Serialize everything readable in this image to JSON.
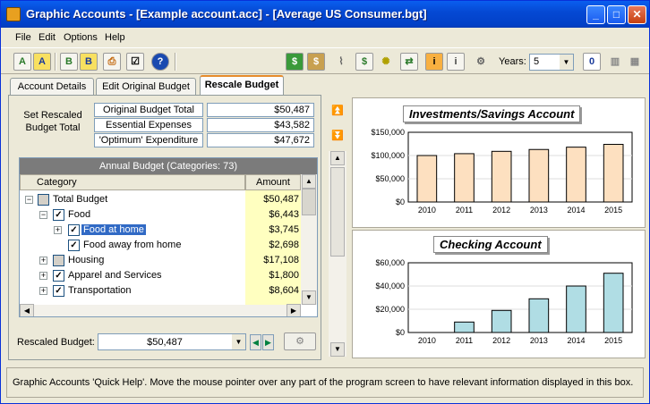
{
  "window": {
    "title": "Graphic Accounts - [Example account.acc] - [Average US Consumer.bgt]",
    "minimize": "_",
    "maximize": "□",
    "close": "✕"
  },
  "menu": [
    "File",
    "Edit",
    "Options",
    "Help"
  ],
  "toolbar": {
    "years_label": "Years:",
    "years_value": "5",
    "zero_button": "0"
  },
  "tabs": [
    "Account Details",
    "Edit Original Budget",
    "Rescale Budget"
  ],
  "summary": {
    "set_label": "Set Rescaled Budget Total",
    "rows": [
      {
        "label": "Original Budget Total",
        "value": "$50,487"
      },
      {
        "label": "Essential Expenses",
        "value": "$43,582"
      },
      {
        "label": "'Optimum' Expenditure",
        "value": "$47,672"
      }
    ]
  },
  "tree": {
    "header": "Annual Budget (Categories:  73)",
    "col_category": "Category",
    "col_amount": "Amount",
    "rows": [
      {
        "label": "Total Budget",
        "amount": "$50,487"
      },
      {
        "label": "Food",
        "amount": "$6,443"
      },
      {
        "label": "Food at home",
        "amount": "$3,745"
      },
      {
        "label": "Food away from home",
        "amount": "$2,698"
      },
      {
        "label": "Housing",
        "amount": "$17,108"
      },
      {
        "label": "Apparel and Services",
        "amount": "$1,800"
      },
      {
        "label": "Transportation",
        "amount": "$8,604"
      }
    ]
  },
  "rescaled": {
    "label": "Rescaled Budget:",
    "value": "$50,487"
  },
  "charts": [
    {
      "title": "Investments/Savings Account",
      "type": "bar",
      "color": "#fde0c0",
      "categories": [
        "2010",
        "2011",
        "2012",
        "2013",
        "2014",
        "2015"
      ],
      "values": [
        100000,
        104000,
        109000,
        113000,
        118000,
        124000
      ],
      "ylim": [
        0,
        150000
      ],
      "yticks": [
        "$0",
        "$50,000",
        "$100,000",
        "$150,000"
      ]
    },
    {
      "title": "Checking Account",
      "type": "bar",
      "color": "#b0dde4",
      "categories": [
        "2010",
        "2011",
        "2012",
        "2013",
        "2014",
        "2015"
      ],
      "values": [
        0,
        9000,
        19000,
        29000,
        40000,
        51000
      ],
      "ylim": [
        0,
        60000
      ],
      "yticks": [
        "$0",
        "$20,000",
        "$40,000",
        "$60,000"
      ]
    }
  ],
  "chart_data": [
    {
      "type": "bar",
      "title": "Investments/Savings Account",
      "categories": [
        "2010",
        "2011",
        "2012",
        "2013",
        "2014",
        "2015"
      ],
      "values": [
        100000,
        104000,
        109000,
        113000,
        118000,
        124000
      ],
      "ylim": [
        0,
        150000
      ]
    },
    {
      "type": "bar",
      "title": "Checking Account",
      "categories": [
        "2010",
        "2011",
        "2012",
        "2013",
        "2014",
        "2015"
      ],
      "values": [
        0,
        9000,
        19000,
        29000,
        40000,
        51000
      ],
      "ylim": [
        0,
        60000
      ]
    }
  ],
  "status": "Graphic Accounts 'Quick Help'.  Move the mouse pointer over any part of the program screen to have relevant information displayed in this box."
}
